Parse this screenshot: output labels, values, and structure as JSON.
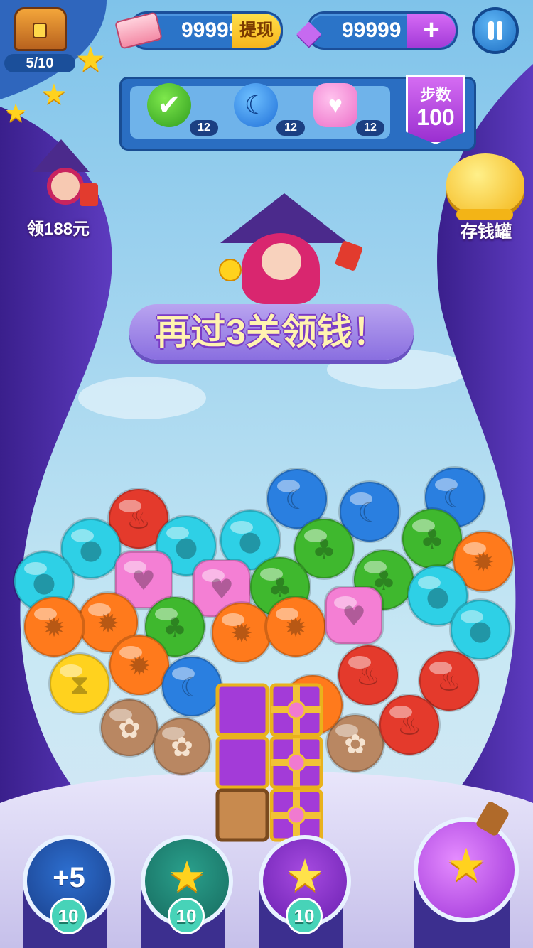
{
  "hud": {
    "chest_progress": "5/10",
    "cash_value": "99999",
    "withdraw_label": "提现",
    "gem_value": "99999",
    "gem_add_label": "+"
  },
  "goals": [
    {
      "icon": "green-check-candy-icon",
      "count": "12",
      "color": "#4cc42a"
    },
    {
      "icon": "blue-moon-candy-icon",
      "count": "12",
      "color": "#2f8ee8"
    },
    {
      "icon": "pink-heart-candy-icon",
      "count": "12",
      "color": "#f58ad6"
    }
  ],
  "steps": {
    "label": "步数",
    "value": "100"
  },
  "side": {
    "left_reward_label": "领188元",
    "right_bank_label": "存钱罐"
  },
  "banner": {
    "text": "再过3关领钱！"
  },
  "boosters": [
    {
      "icon": "hand-plus-icon",
      "label": "+5",
      "count": "10"
    },
    {
      "icon": "rainbow-star-icon",
      "label": "",
      "count": "10"
    },
    {
      "icon": "star-wand-icon",
      "label": "",
      "count": "10"
    }
  ],
  "colors": {
    "red": "#e43a2c",
    "cyan": "#2ed0e6",
    "blue": "#2a7fe0",
    "green": "#3fb82e",
    "pink": "#f47fd4",
    "orange": "#ff7a1c",
    "yellow": "#ffd21e",
    "paw": "#b98762",
    "purple": "#a73be0"
  },
  "board": {
    "pieces": [
      {
        "type": "red",
        "icon": "fire-icon"
      },
      {
        "type": "blue",
        "icon": "moon-icon"
      },
      {
        "type": "blue",
        "icon": "moon-icon"
      },
      {
        "type": "cyan",
        "icon": "drop-icon"
      },
      {
        "type": "cyan",
        "icon": "drop-icon"
      },
      {
        "type": "cyan",
        "icon": "drop-icon"
      },
      {
        "type": "blue",
        "icon": "moon-icon"
      },
      {
        "type": "green",
        "icon": "leaf-icon"
      },
      {
        "type": "green",
        "icon": "leaf-icon"
      },
      {
        "type": "cyan",
        "icon": "drop-icon"
      },
      {
        "type": "pink",
        "icon": "heart-icon"
      },
      {
        "type": "pink",
        "icon": "heart-icon"
      },
      {
        "type": "green",
        "icon": "leaf-icon"
      },
      {
        "type": "green",
        "icon": "leaf-icon"
      },
      {
        "type": "orange",
        "icon": "sun-icon"
      },
      {
        "type": "orange",
        "icon": "sun-icon"
      },
      {
        "type": "orange",
        "icon": "sun-icon"
      },
      {
        "type": "green",
        "icon": "leaf-icon"
      },
      {
        "type": "orange",
        "icon": "sun-icon"
      },
      {
        "type": "orange",
        "icon": "sun-icon"
      },
      {
        "type": "pink",
        "icon": "heart-icon"
      },
      {
        "type": "cyan",
        "icon": "drop-icon"
      },
      {
        "type": "cyan",
        "icon": "drop-icon"
      },
      {
        "type": "orange",
        "icon": "sun-icon"
      },
      {
        "type": "yellow",
        "icon": "hourglass-icon"
      },
      {
        "type": "blue",
        "icon": "moon-icon"
      },
      {
        "type": "red",
        "icon": "fire-icon"
      },
      {
        "type": "red",
        "icon": "fire-icon"
      },
      {
        "type": "paw",
        "icon": "paw-icon"
      },
      {
        "type": "paw",
        "icon": "paw-icon"
      },
      {
        "type": "paw",
        "icon": "paw-icon"
      },
      {
        "type": "red",
        "icon": "fire-icon"
      },
      {
        "type": "orange",
        "icon": "sun-icon"
      }
    ]
  }
}
